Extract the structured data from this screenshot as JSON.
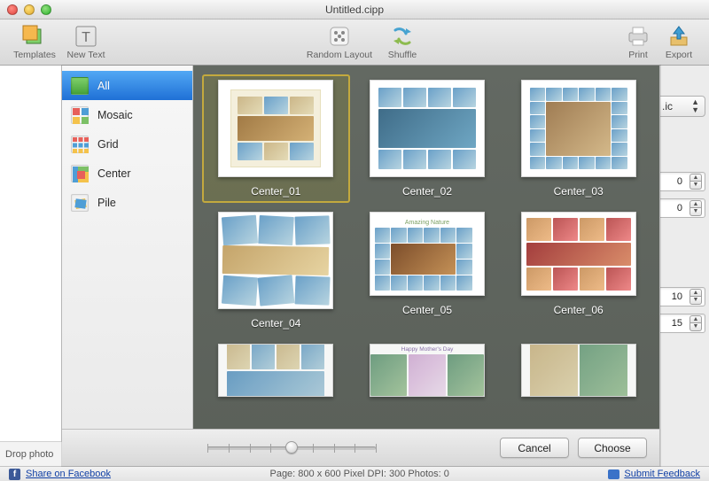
{
  "window": {
    "title": "Untitled.cipp"
  },
  "toolbar": {
    "templates": "Templates",
    "newtext": "New Text",
    "random": "Random Layout",
    "shuffle": "Shuffle",
    "print": "Print",
    "export": "Export"
  },
  "sidebar_drop": "Drop photo",
  "status": {
    "share": "Share on Facebook",
    "info": "Page: 800 x 600 Pixel  DPI: 300 Photos: 0",
    "feedback": "Submit Feedback"
  },
  "chooser": {
    "categories": [
      {
        "label": "All",
        "icon": "all"
      },
      {
        "label": "Mosaic",
        "icon": "mosaic"
      },
      {
        "label": "Grid",
        "icon": "grid"
      },
      {
        "label": "Center",
        "icon": "center"
      },
      {
        "label": "Pile",
        "icon": "pile"
      }
    ],
    "active_category": 0,
    "templates": [
      {
        "name": "Center_01"
      },
      {
        "name": "Center_02"
      },
      {
        "name": "Center_03"
      },
      {
        "name": "Center_04"
      },
      {
        "name": "Center_05"
      },
      {
        "name": "Center_06"
      }
    ],
    "selected_template": 0,
    "buttons": {
      "cancel": "Cancel",
      "choose": "Choose"
    }
  },
  "rightpanel": {
    "select_tail": ".ic",
    "fields": [
      "0",
      "0",
      "10",
      "15"
    ]
  },
  "annotations": {
    "t5": "Amazing Nature",
    "t8": "Happy Mother's Day"
  }
}
